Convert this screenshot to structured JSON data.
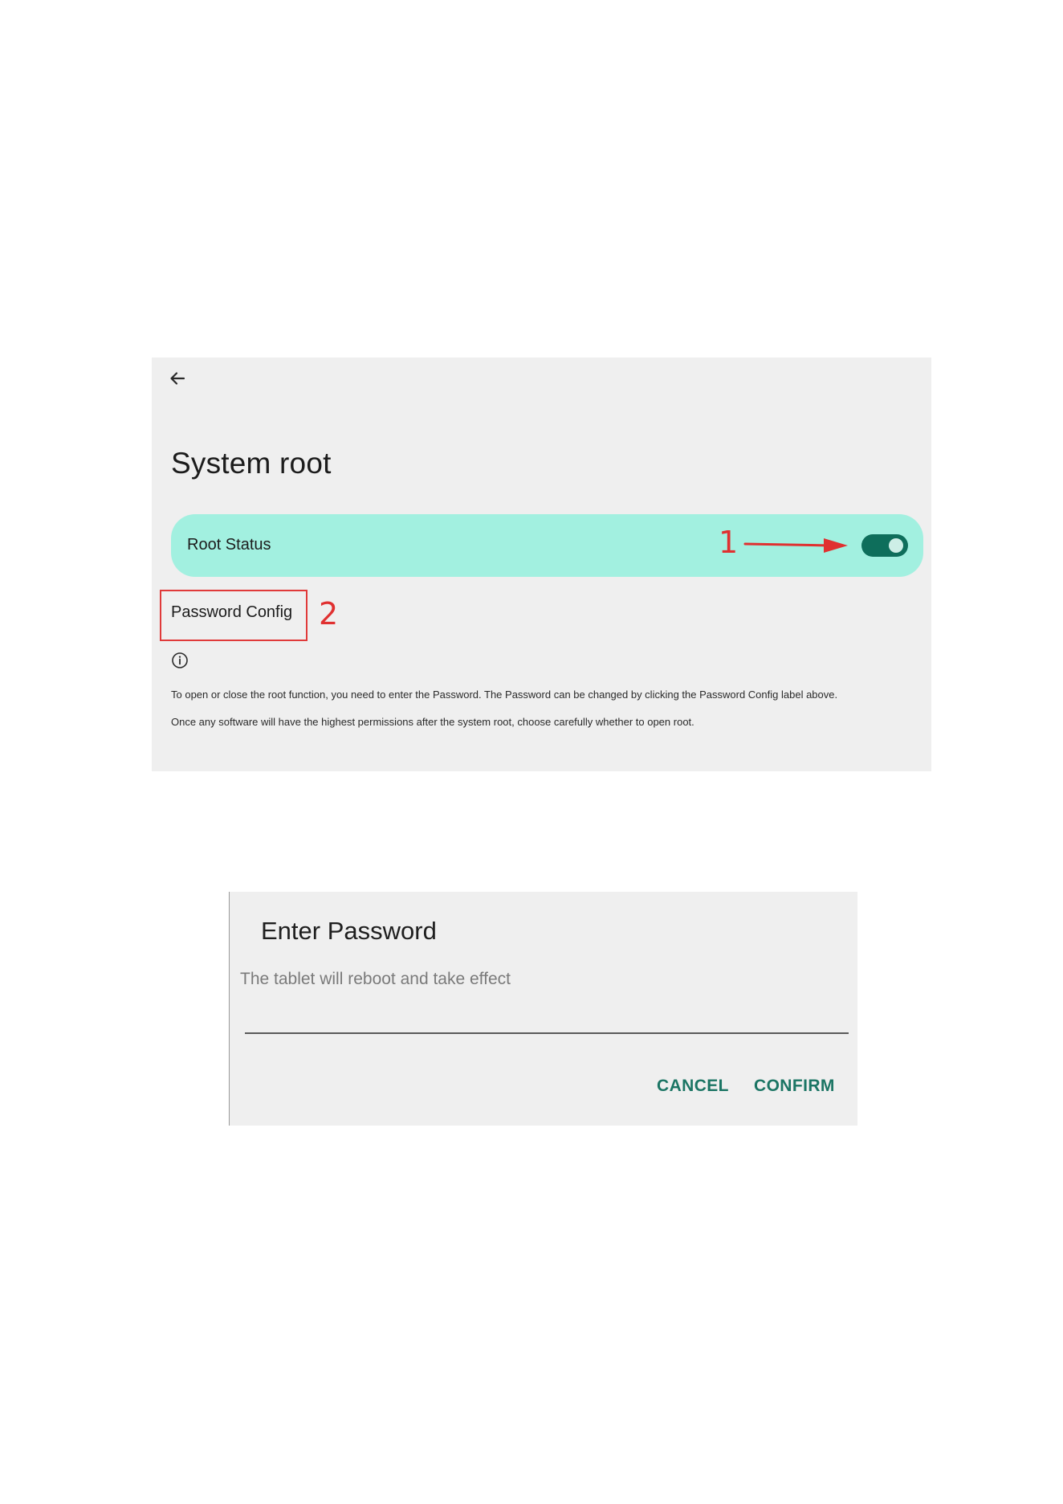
{
  "settings": {
    "title": "System root",
    "root_status_label": "Root Status",
    "root_status_enabled": true,
    "password_config_label": "Password Config",
    "info_line_1": "To open or close the root function, you need to enter the Password. The Password can be changed by clicking the Password Config label above.",
    "info_line_2": "Once any software will have the highest permissions after the system root, choose carefully whether to open root."
  },
  "annotations": {
    "step_1": "1",
    "step_2": "2",
    "color": "#e03030"
  },
  "dialog": {
    "title": "Enter Password",
    "message": "The tablet will reboot and take effect",
    "password_value": "",
    "cancel_label": "CANCEL",
    "confirm_label": "CONFIRM"
  },
  "colors": {
    "accent": "#0e6e5b",
    "highlight_row": "#a2f0e0",
    "dialog_button": "#1b7564"
  },
  "icons": {
    "back": "arrow-left-icon",
    "info": "info-circle-icon"
  }
}
